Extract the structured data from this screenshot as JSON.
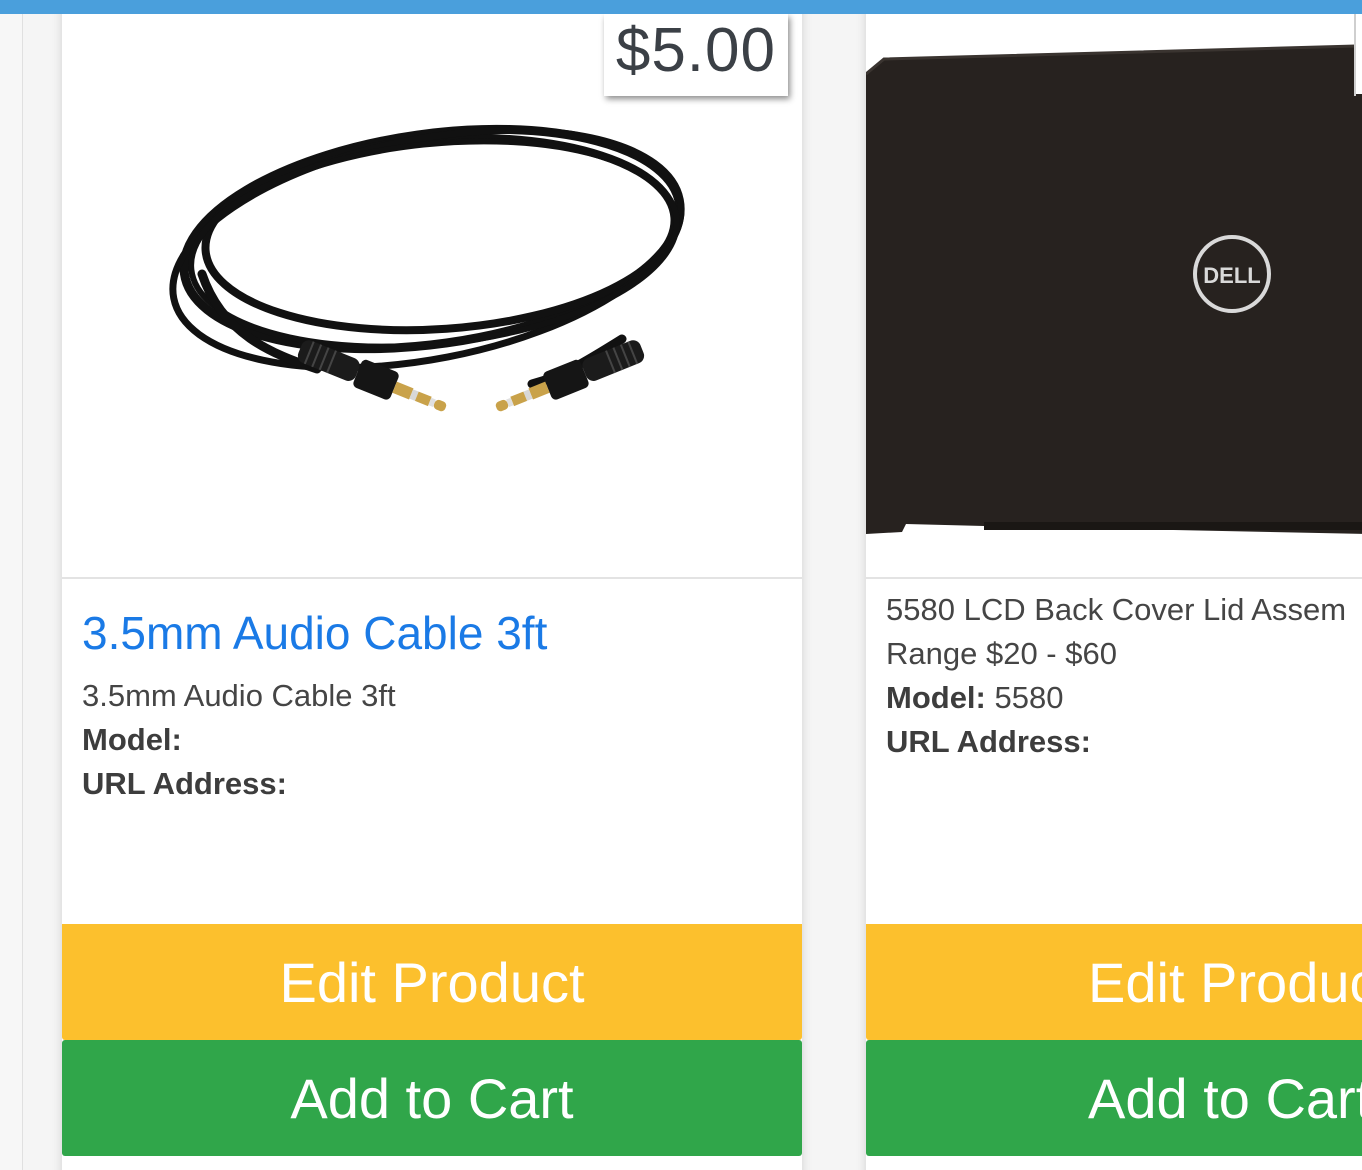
{
  "products": [
    {
      "price": "$5.00",
      "title": "3.5mm Audio Cable 3ft",
      "description": "3.5mm Audio Cable 3ft",
      "model_label": "Model:",
      "model_value": "",
      "url_label": "URL Address:",
      "url_value": "",
      "edit_label": "Edit Product",
      "cart_label": "Add to Cart",
      "image_icon": "audio-cable-image"
    },
    {
      "description": "5580 LCD Back Cover Lid Assem",
      "range": "Range $20 - $60",
      "model_label": "Model:",
      "model_value": "5580",
      "url_label": "URL Address:",
      "url_value": "",
      "edit_label": "Edit Produc",
      "cart_label": "Add to Cart",
      "image_icon": "laptop-lid-image",
      "logo_text": "DELL"
    }
  ],
  "colors": {
    "topbar": "#4a9fdc",
    "edit_button": "#fcc02d",
    "cart_button": "#30a64a",
    "title_link": "#1a7ae6"
  }
}
